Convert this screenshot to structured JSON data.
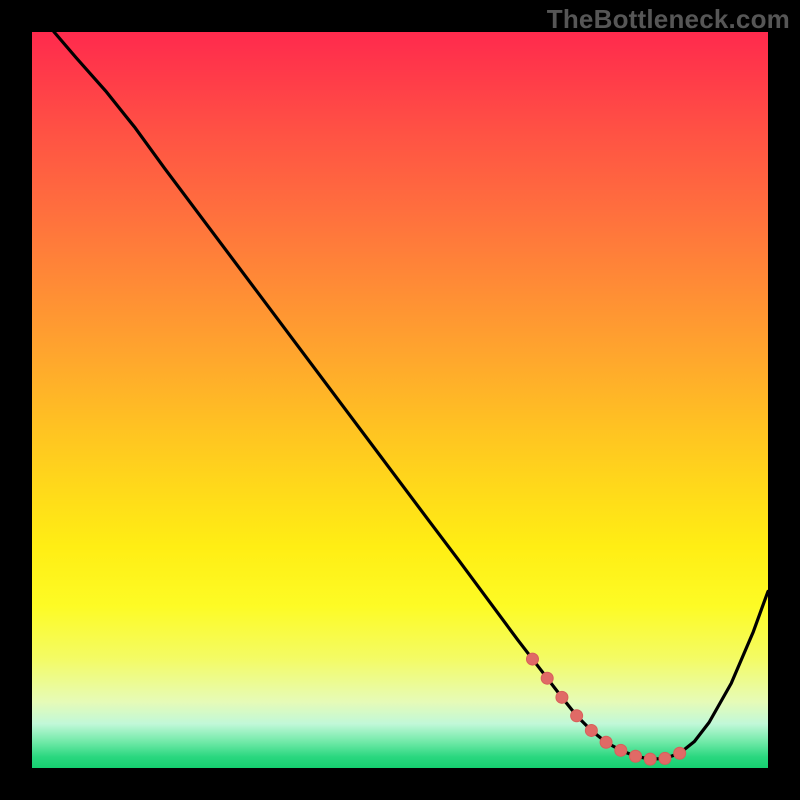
{
  "watermark": "TheBottleneck.com",
  "colors": {
    "main_line": "#000000",
    "dot_fill": "#e06a66",
    "dot_stroke": "#d85f5b"
  },
  "chart_data": {
    "type": "line",
    "title": "",
    "xlabel": "",
    "ylabel": "",
    "xlim": [
      0,
      100
    ],
    "ylim": [
      0,
      100
    ],
    "series": [
      {
        "name": "main-curve",
        "x": [
          0,
          3,
          6,
          10,
          14,
          18,
          24,
          30,
          36,
          42,
          48,
          54,
          58,
          62,
          66,
          68,
          70,
          72,
          74,
          76,
          78,
          80,
          82,
          84,
          86,
          88,
          90,
          92,
          95,
          98,
          100
        ],
        "values": [
          105,
          100,
          96.5,
          92,
          87,
          81.5,
          73.5,
          65.5,
          57.5,
          49.5,
          41.5,
          33.5,
          28.2,
          22.8,
          17.4,
          14.8,
          12.2,
          9.6,
          7.1,
          5.1,
          3.5,
          2.4,
          1.6,
          1.2,
          1.3,
          2.0,
          3.6,
          6.2,
          11.5,
          18.5,
          24.0
        ]
      }
    ],
    "highlight_dots": {
      "from_index": 15,
      "to_index": 25,
      "radius": 6
    }
  }
}
